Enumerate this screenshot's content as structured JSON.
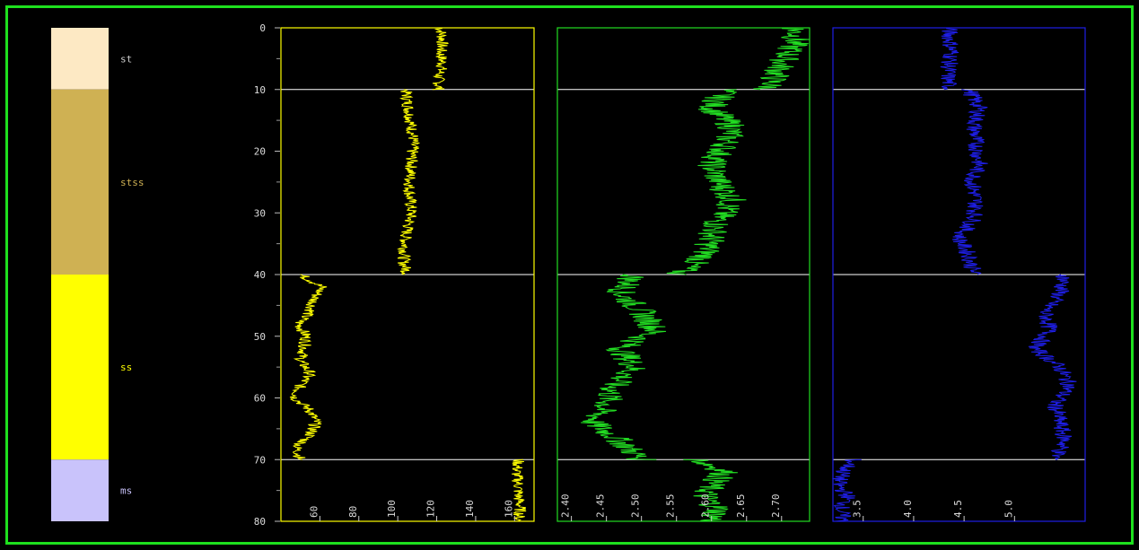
{
  "colors": {
    "background": "#000000",
    "frame": "#1ee01e",
    "boundary": "#ffffff",
    "depth_label": "#dcdcdc"
  },
  "chart_data": {
    "type": "line",
    "title": "",
    "depth_axis": {
      "label": "",
      "range": [
        0,
        80
      ],
      "ticks": [
        "0",
        "10",
        "20",
        "30",
        "40",
        "50",
        "60",
        "70",
        "80"
      ]
    },
    "grid": false,
    "boundaries": [
      10,
      40,
      70
    ],
    "lithology": [
      {
        "name": "st",
        "label": "st",
        "top": 0,
        "bottom": 10,
        "color": "#fde9c4",
        "label_color": "#cfcfcf"
      },
      {
        "name": "stss",
        "label": "stss",
        "top": 10,
        "bottom": 40,
        "color": "#cfb153",
        "label_color": "#cfb153"
      },
      {
        "name": "ss",
        "label": "ss",
        "top": 40,
        "bottom": 70,
        "color": "#ffff00",
        "label_color": "#ffff00"
      },
      {
        "name": "ms",
        "label": "ms",
        "top": 70,
        "bottom": 80,
        "color": "#c9c3fb",
        "label_color": "#c9c3fb"
      }
    ],
    "tracks": [
      {
        "name": "track-1",
        "color": "#ffff00",
        "xlim": [
          40,
          170
        ],
        "ticks": [
          "60",
          "80",
          "100",
          "120",
          "140",
          "160"
        ],
        "tick_values": [
          60,
          80,
          100,
          120,
          140,
          160
        ],
        "series": [
          {
            "depth": [
              0,
              2,
              4,
              6,
              8,
              10
            ],
            "values": [
              122,
              123,
              122,
              123,
              121,
              121
            ]
          },
          {
            "depth": [
              10,
              14,
              18,
              22,
              26,
              30,
              34,
              38,
              40
            ],
            "values": [
              104,
              106,
              108,
              107,
              106,
              107,
              104,
              103,
              105
            ]
          },
          {
            "depth": [
              40,
              42,
              44,
              46,
              48,
              50,
              52,
              54,
              56,
              58,
              60,
              62,
              64,
              66,
              68,
              70
            ],
            "values": [
              50,
              61,
              57,
              55,
              49,
              53,
              52,
              50,
              55,
              50,
              47,
              55,
              58,
              55,
              48,
              50
            ]
          },
          {
            "depth": [
              70,
              72,
              74,
              76,
              78,
              80
            ],
            "values": [
              162,
              161,
              162,
              162,
              163,
              162
            ]
          }
        ]
      },
      {
        "name": "track-2",
        "color": "#22dd22",
        "xlim": [
          2.38,
          2.74
        ],
        "ticks": [
          "2.40",
          "2.45",
          "2.50",
          "2.55",
          "2.60",
          "2.65",
          "2.70"
        ],
        "tick_values": [
          2.4,
          2.45,
          2.5,
          2.55,
          2.6,
          2.65,
          2.7
        ],
        "series": [
          {
            "depth": [
              0,
              2,
              4,
              6,
              8,
              10
            ],
            "values": [
              2.72,
              2.72,
              2.71,
              2.7,
              2.69,
              2.68
            ]
          },
          {
            "depth": [
              10,
              13,
              16,
              19,
              22,
              25,
              28,
              31,
              34,
              37,
              40
            ],
            "values": [
              2.62,
              2.6,
              2.63,
              2.62,
              2.6,
              2.61,
              2.63,
              2.61,
              2.6,
              2.59,
              2.55
            ]
          },
          {
            "depth": [
              40,
              43,
              46,
              49,
              52,
              55,
              58,
              61,
              64,
              67,
              70
            ],
            "values": [
              2.49,
              2.47,
              2.5,
              2.52,
              2.47,
              2.49,
              2.46,
              2.45,
              2.43,
              2.47,
              2.5
            ]
          },
          {
            "depth": [
              70,
              72,
              74,
              76,
              78,
              80
            ],
            "values": [
              2.58,
              2.62,
              2.6,
              2.59,
              2.61,
              2.6
            ]
          }
        ]
      },
      {
        "name": "track-3",
        "color": "#1e1ee6",
        "xlim": [
          3.2,
          5.7
        ],
        "ticks": [
          "3.5",
          "4.0",
          "4.5",
          "5.0"
        ],
        "tick_values": [
          3.5,
          4.0,
          4.5,
          5.0
        ],
        "series": [
          {
            "depth": [
              0,
              2,
              4,
              6,
              8,
              10
            ],
            "values": [
              4.35,
              4.36,
              4.38,
              4.35,
              4.34,
              4.35
            ]
          },
          {
            "depth": [
              10,
              13,
              16,
              19,
              22,
              25,
              28,
              31,
              34,
              37,
              40
            ],
            "values": [
              4.55,
              4.65,
              4.6,
              4.62,
              4.65,
              4.58,
              4.62,
              4.6,
              4.45,
              4.55,
              4.6
            ]
          },
          {
            "depth": [
              40,
              43,
              46,
              49,
              52,
              55,
              58,
              61,
              64,
              67,
              70
            ],
            "values": [
              5.5,
              5.45,
              5.3,
              5.35,
              5.2,
              5.45,
              5.55,
              5.4,
              5.45,
              5.5,
              5.4
            ]
          },
          {
            "depth": [
              70,
              72,
              74,
              76,
              78,
              80
            ],
            "values": [
              3.4,
              3.3,
              3.25,
              3.35,
              3.28,
              3.3
            ]
          }
        ]
      }
    ]
  }
}
